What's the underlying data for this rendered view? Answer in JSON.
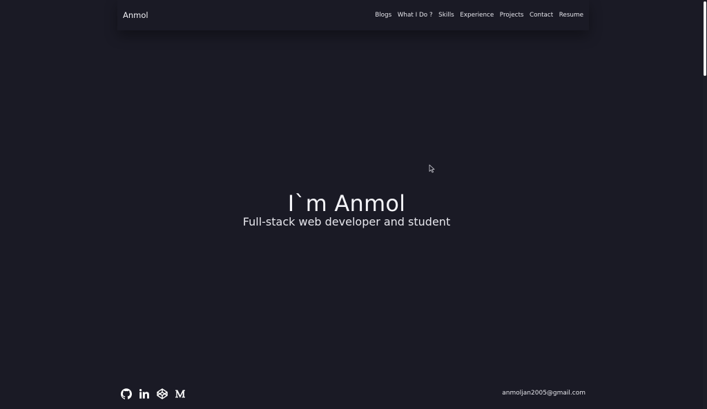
{
  "navbar": {
    "brand": "Anmol",
    "links": [
      {
        "label": "Blogs"
      },
      {
        "label": "What I Do ?"
      },
      {
        "label": "Skills"
      },
      {
        "label": "Experience"
      },
      {
        "label": "Projects"
      },
      {
        "label": "Contact"
      },
      {
        "label": "Resume"
      }
    ]
  },
  "hero": {
    "title": "I`m Anmol",
    "subtitle": "Full-stack web developer and student"
  },
  "footer": {
    "socials": [
      {
        "icon": "github-icon"
      },
      {
        "icon": "linkedin-icon"
      },
      {
        "icon": "codepen-icon"
      },
      {
        "icon": "medium-icon"
      }
    ],
    "email": "anmoljan2005@gmail.com"
  },
  "colors": {
    "background": "#1a1a25",
    "text": "#ffffff"
  }
}
